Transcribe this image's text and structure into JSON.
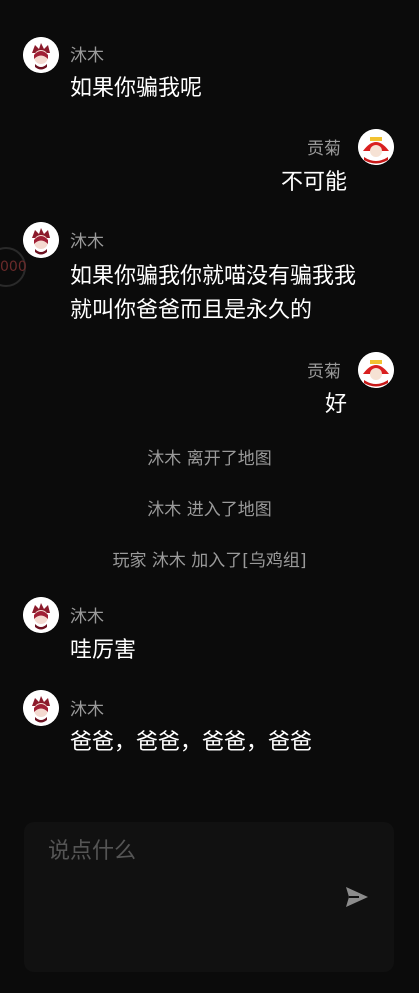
{
  "messages": [
    {
      "sender": "沐木",
      "text": "如果你骗我呢"
    },
    {
      "sender": "贡菊",
      "text": "不可能"
    },
    {
      "sender": "沐木",
      "lines": [
        "如果你骗我你就喵没有骗我我",
        "就叫你爸爸而且是永久的"
      ]
    },
    {
      "sender": "贡菊",
      "text": "好"
    },
    {
      "sender": "沐木",
      "text": "哇厉害"
    },
    {
      "sender": "沐木",
      "text": "爸爸，爸爸，爸爸，爸爸"
    }
  ],
  "system_notices": [
    "沐木 离开了地图",
    "沐木 进入了地图",
    "玩家 沐木 加入了[乌鸡组]"
  ],
  "overlay_text": "000",
  "composer": {
    "placeholder": "说点什么"
  },
  "icons": {
    "send": "send-icon",
    "avatar_left": "avatar-icon",
    "avatar_right": "avatar-icon"
  },
  "colors": {
    "background": "#0b0b0b",
    "name": "#9a9a9a",
    "message": "#ffffff",
    "composer_bg": "#111111",
    "placeholder": "#555555"
  }
}
